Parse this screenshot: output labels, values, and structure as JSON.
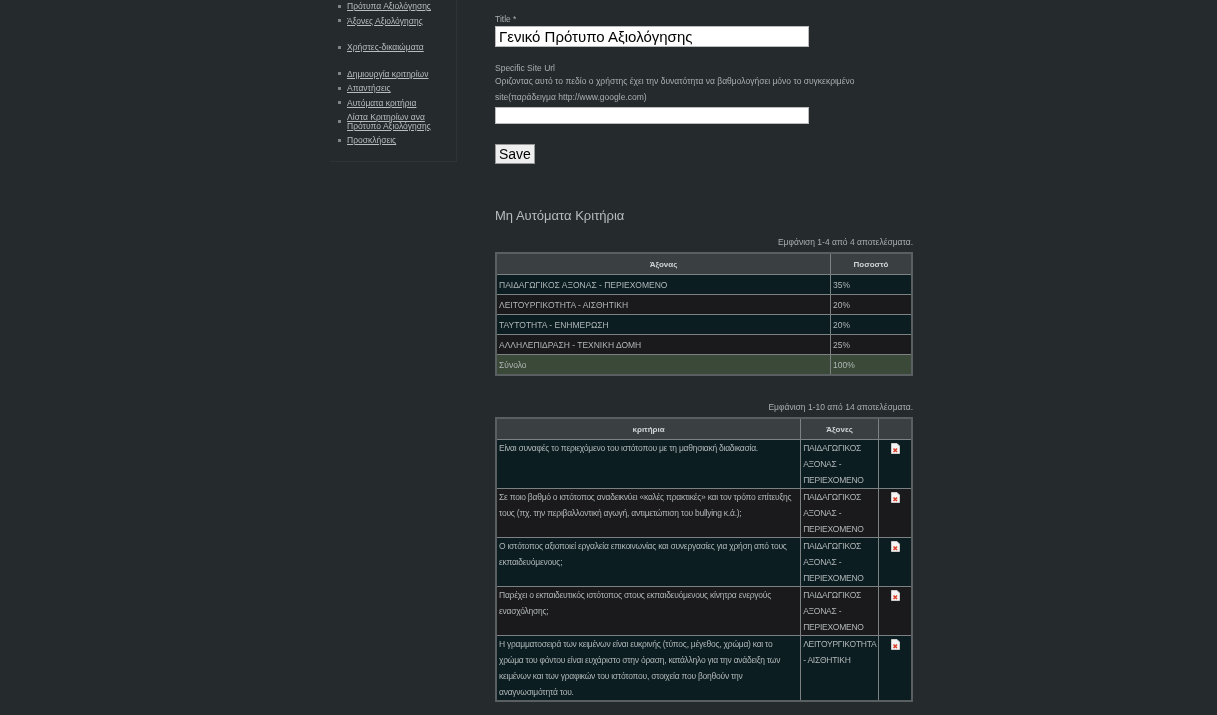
{
  "sidebar": {
    "groups": [
      {
        "items": [
          {
            "label": "Πρότυπα Αξιολόγησης"
          },
          {
            "label": "Άξονες Αξιολόγησης"
          }
        ]
      },
      {
        "items": [
          {
            "label": "Χρήστες-δικαιώματα"
          }
        ]
      },
      {
        "items": [
          {
            "label": "Δημιουργία κριτηρίων"
          },
          {
            "label": "Απαντήσεις"
          },
          {
            "label": "Αυτόματα κριτήρια"
          },
          {
            "label": "Λίστα Κριτηρίων ανα Πρότυπο Αξιολόγησης"
          },
          {
            "label": "Προσκλήσεις"
          }
        ]
      }
    ]
  },
  "form": {
    "title_label": "Title *",
    "title_value": "Γενικό Πρότυπο Αξιολόγησης",
    "url_label": "Specific Site Url",
    "url_hint": "Οριζοντας αυτό το πεδίο ο χρήστης έχει την δυνατότητα να βαθμολογήσει μόνο το συγκεκριμένο site(παράδειγμα http://www.google.com)",
    "save": "Save"
  },
  "axes_section": {
    "heading": "Μη Αυτόματα Κριτήρια",
    "summary": "Εμφάνιση 1-4 από 4 αποτελέσματα.",
    "columns": [
      "Άξονας",
      "Ποσοστό"
    ],
    "rows": [
      {
        "axis": "ΠΑΙΔΑΓΩΓΙΚΟΣ ΑΞΟΝΑΣ - ΠΕΡΙΕΧΟΜΕΝΟ",
        "percent": "35%"
      },
      {
        "axis": "ΛΕΙΤΟΥΡΓΙΚΟΤΗΤΑ - ΑΙΣΘΗΤΙΚΗ",
        "percent": "20%"
      },
      {
        "axis": "ΤΑΥΤΟΤΗΤΑ - ΕΝΗΜΕΡΩΣΗ",
        "percent": "20%"
      },
      {
        "axis": "ΑΛΛΗΛΕΠΙΔΡΑΣΗ - ΤΕΧΝΙΚΗ ΔΟΜΗ",
        "percent": "25%"
      }
    ],
    "total": {
      "label": "Σύνολο",
      "percent": "100%"
    }
  },
  "criteria_section": {
    "summary": "Εμφάνιση 1-10 από 14 αποτελέσματα.",
    "columns": [
      "κριτήρια",
      "Άξονες"
    ],
    "rows": [
      {
        "criterion": "Είναι συναφές το περιεχόμενο του ιστότοπου με τη μαθησιακή διαδικασία.",
        "axis": "ΠΑΙΔΑΓΩΓΙΚΟΣ ΑΞΟΝΑΣ - ΠΕΡΙΕΧΟΜΕΝΟ"
      },
      {
        "criterion": "Σε ποιο βαθμό ο ιστότοπος αναδεικνύει «καλές πρακτικές» και τον τρόπο επίτευξης τους (πχ. την περιβαλλοντική αγωγή, αντιμετώπιση του bullying κ.ά.);",
        "axis": "ΠΑΙΔΑΓΩΓΙΚΟΣ ΑΞΟΝΑΣ - ΠΕΡΙΕΧΟΜΕΝΟ"
      },
      {
        "criterion": "Ο ιστότοπος αξιοποιεί εργαλεία επικοινωνίας και συνεργασίες για χρήση από τους εκπαιδευόμενους;",
        "axis": "ΠΑΙΔΑΓΩΓΙΚΟΣ ΑΞΟΝΑΣ - ΠΕΡΙΕΧΟΜΕΝΟ"
      },
      {
        "criterion": "Παρέχει ο εκπαιδευτικός ιστότοπος στους εκπαιδευόμενους κίνητρα ενεργούς ενασχόλησης;",
        "axis": "ΠΑΙΔΑΓΩΓΙΚΟΣ ΑΞΟΝΑΣ - ΠΕΡΙΕΧΟΜΕΝΟ"
      },
      {
        "criterion": "Η γραμματοσειρά των κειμένων είναι ευκρινής (τύπος, μέγεθος, χρώμα) και το χρώμα του φόντου είναι ευχάριστο στην όραση, κατάλληλο για την ανάδειξη των κειμένων και των γραφικών του ιστότοπου, στοιχεία που βοηθούν την αναγνωσιμότητά του.",
        "axis": "ΛΕΙΤΟΥΡΓΙΚΟΤΗΤΑ - ΑΙΣΘΗΤΙΚΗ"
      }
    ]
  }
}
